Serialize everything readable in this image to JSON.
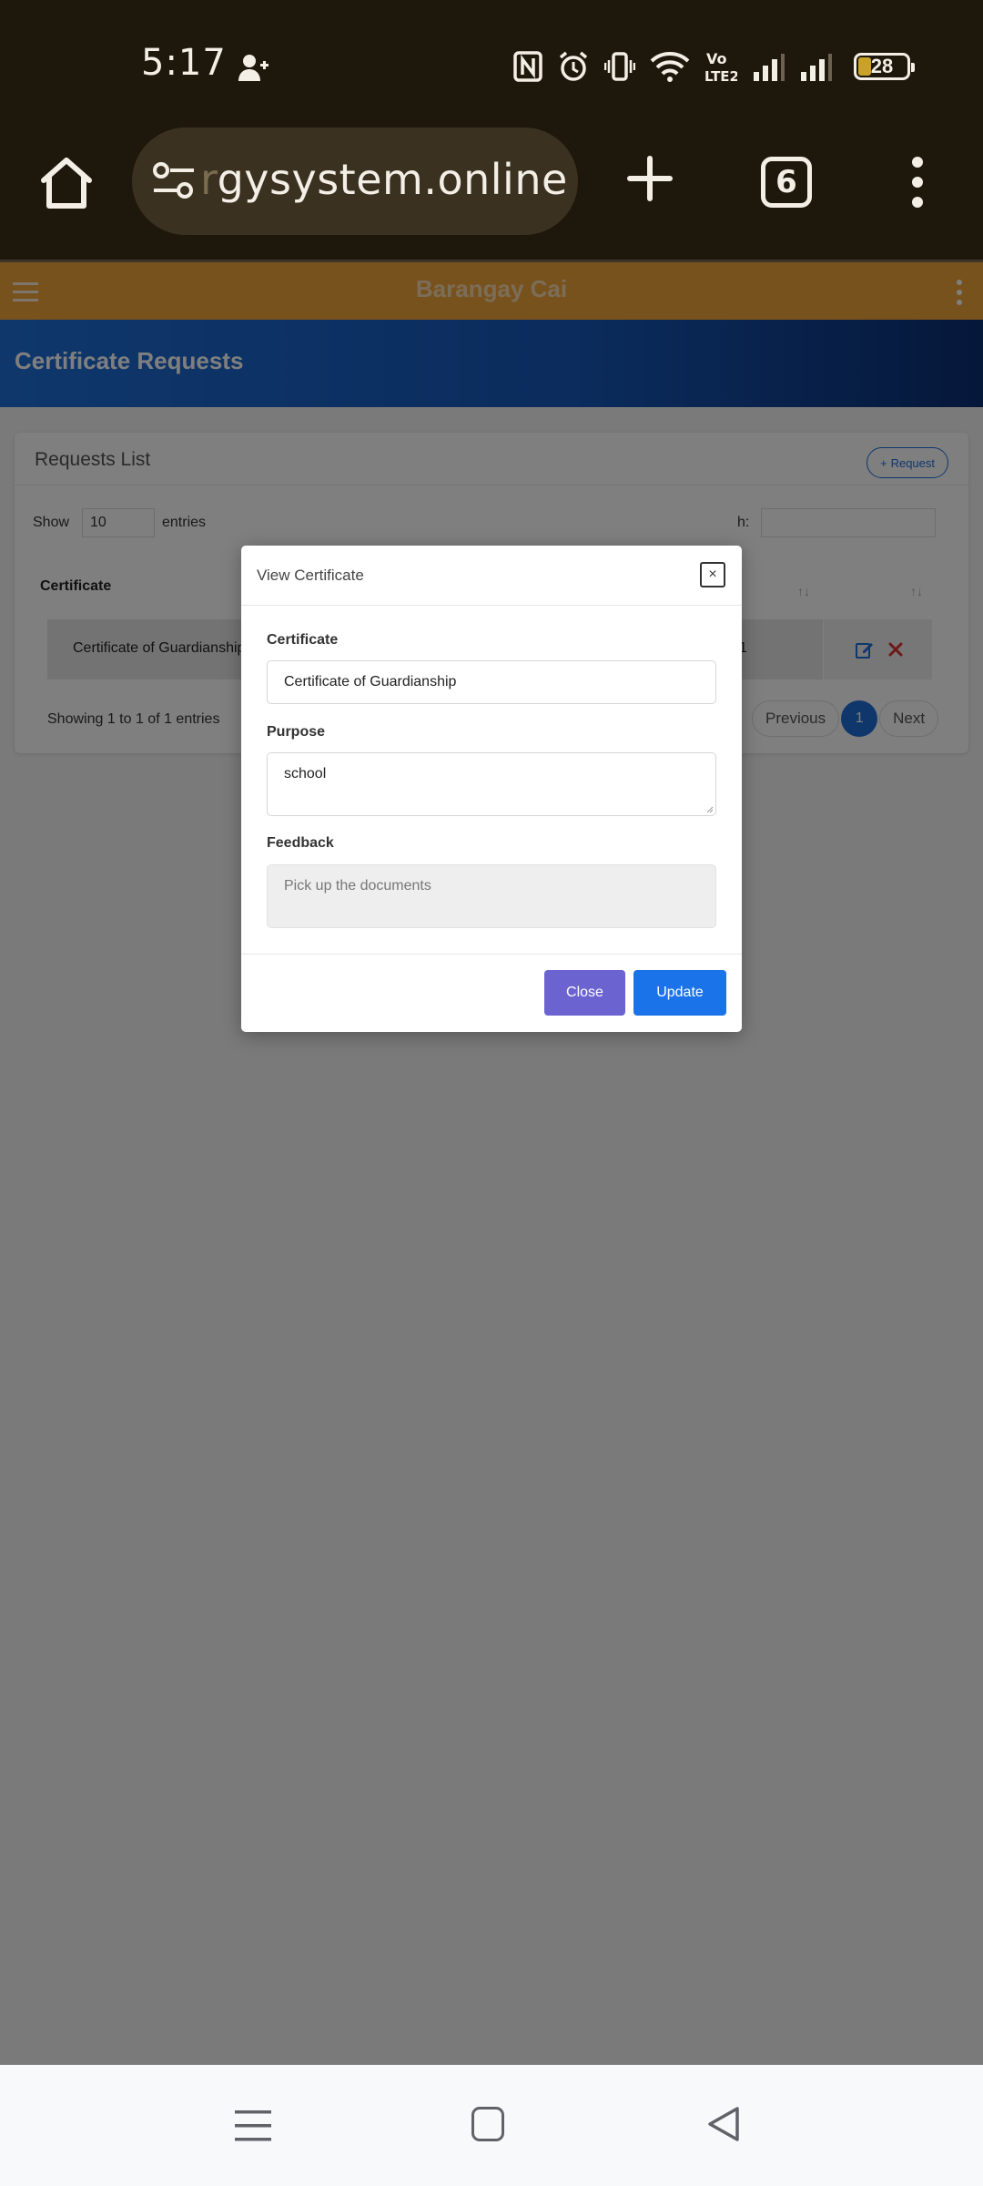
{
  "status_bar": {
    "time": "5:17",
    "battery": "28",
    "icons": [
      "person-add-icon",
      "nfc-icon",
      "alarm-icon",
      "vibrate-icon",
      "wifi-icon",
      "volte-icon",
      "signal-icon",
      "signal-icon",
      "battery-icon"
    ],
    "volte_text": "Vo LTE2"
  },
  "browser": {
    "url_faded": "r",
    "url": "gysystem.online",
    "tab_count": "6"
  },
  "site": {
    "header_title": "Barangay Cai",
    "page_title": "Certificate Requests",
    "card_title": "Requests List",
    "request_button": "Request",
    "show_label": "Show",
    "length_value": "10",
    "entries_label": "entries",
    "search_label": "h:",
    "table": {
      "header_certificate": "Certificate",
      "sort_glyph": "↑↓",
      "row_certificate": "Certificate of Guardianship",
      "row_fragment": "1"
    },
    "info": "Showing 1 to 1 of 1 entries",
    "pager": {
      "previous": "Previous",
      "current": "1",
      "next": "Next"
    }
  },
  "modal": {
    "title": "View Certificate",
    "close_symbol": "×",
    "certificate_label": "Certificate",
    "certificate_value": "Certificate of Guardianship",
    "purpose_label": "Purpose",
    "purpose_value": "school",
    "feedback_label": "Feedback",
    "feedback_value": "Pick up the documents",
    "close_button": "Close",
    "update_button": "Update"
  },
  "colors": {
    "site_header": "#f0a53a",
    "banner": "#1e6fd9",
    "close_button": "#6b63cf",
    "update_button": "#1a73e8"
  }
}
